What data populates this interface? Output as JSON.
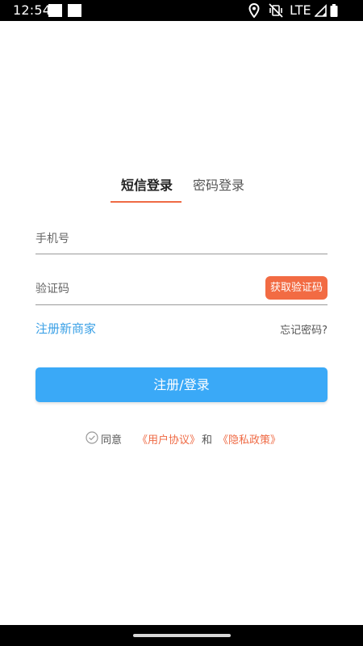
{
  "status_bar": {
    "time": "12:54",
    "network": "LTE",
    "icons": [
      "notification-icon",
      "notification-icon",
      "location-icon",
      "vibrate-off-icon",
      "signal-icon",
      "battery-icon"
    ]
  },
  "tabs": [
    {
      "label": "短信登录",
      "active": true
    },
    {
      "label": "密码登录",
      "active": false
    }
  ],
  "form": {
    "phone_placeholder": "手机号",
    "code_placeholder": "验证码",
    "get_code_label": "获取验证码",
    "register_link": "注册新商家",
    "forgot_link": "忘记密码?",
    "submit_label": "注册/登录"
  },
  "agreement": {
    "agree_text": "同意",
    "user_agreement": "《用户协议》",
    "and_text": "和",
    "privacy_policy": "《隐私政策》",
    "checked": false
  },
  "colors": {
    "accent_orange": "#ef6a44",
    "primary_blue": "#3aa9f7",
    "link_blue": "#3aa0e6"
  }
}
